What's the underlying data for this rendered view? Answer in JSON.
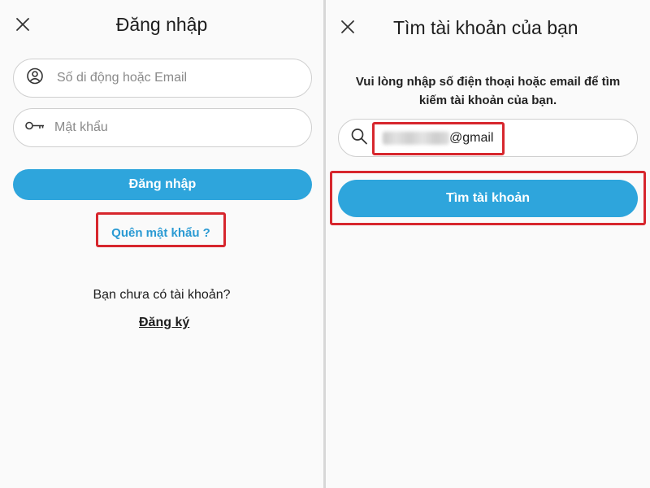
{
  "login": {
    "title": "Đăng nhập",
    "phone_email_placeholder": "Số di động hoặc Email",
    "password_placeholder": "Mật khẩu",
    "login_button": "Đăng nhập",
    "forgot_password": "Quên mật khẩu ?",
    "no_account": "Bạn chưa có tài khoản?",
    "register": "Đăng ký"
  },
  "find_account": {
    "title": "Tìm tài khoản của bạn",
    "description_line1": "Vui lòng nhập số điện thoại hoặc email để tìm",
    "description_line2": "kiếm tài khoản của bạn.",
    "search_value_suffix": "@gmail",
    "find_button": "Tìm tài khoản"
  },
  "colors": {
    "accent": "#2ea5dc",
    "highlight_box": "#d7262d",
    "link": "#2a9ad3"
  }
}
